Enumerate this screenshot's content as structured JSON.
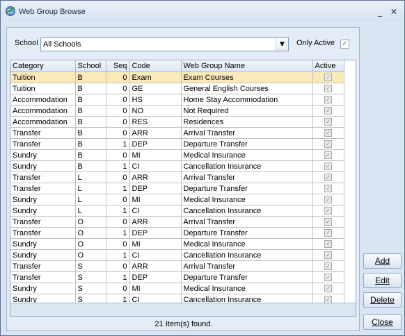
{
  "window": {
    "title": "Web Group Browse",
    "min_icon": "minimize-icon",
    "close_icon": "close-icon",
    "min_glyph": "_",
    "close_glyph": "✕"
  },
  "filter": {
    "school_label": "School",
    "school_value": "All Schools",
    "only_active_label": "Only Active",
    "only_active_checked": true
  },
  "grid": {
    "columns": [
      "Category",
      "School",
      "Seq",
      "Code",
      "Web Group Name",
      "Active"
    ],
    "rows": [
      {
        "category": "Tuition",
        "school": "B",
        "seq": "0",
        "code": "Exam",
        "name": "Exam Courses",
        "active": true
      },
      {
        "category": "Tuition",
        "school": "B",
        "seq": "0",
        "code": "GE",
        "name": "General English Courses",
        "active": true
      },
      {
        "category": "Accommodation",
        "school": "B",
        "seq": "0",
        "code": "HS",
        "name": "Home Stay Accommodation",
        "active": true
      },
      {
        "category": "Accommodation",
        "school": "B",
        "seq": "0",
        "code": "NO",
        "name": "Not Required",
        "active": true
      },
      {
        "category": "Accommodation",
        "school": "B",
        "seq": "0",
        "code": "RES",
        "name": "Residences",
        "active": true
      },
      {
        "category": "Transfer",
        "school": "B",
        "seq": "0",
        "code": "ARR",
        "name": "Arrival Transfer",
        "active": true
      },
      {
        "category": "Transfer",
        "school": "B",
        "seq": "1",
        "code": "DEP",
        "name": "Departure Transfer",
        "active": true
      },
      {
        "category": "Sundry",
        "school": "B",
        "seq": "0",
        "code": "MI",
        "name": "Medical Insurance",
        "active": true
      },
      {
        "category": "Sundry",
        "school": "B",
        "seq": "1",
        "code": "CI",
        "name": "Cancellation Insurance",
        "active": true
      },
      {
        "category": "Transfer",
        "school": "L",
        "seq": "0",
        "code": "ARR",
        "name": "Arrival Transfer",
        "active": true
      },
      {
        "category": "Transfer",
        "school": "L",
        "seq": "1",
        "code": "DEP",
        "name": "Departure Transfer",
        "active": true
      },
      {
        "category": "Sundry",
        "school": "L",
        "seq": "0",
        "code": "MI",
        "name": "Medical Insurance",
        "active": true
      },
      {
        "category": "Sundry",
        "school": "L",
        "seq": "1",
        "code": "CI",
        "name": "Cancellation Insurance",
        "active": true
      },
      {
        "category": "Transfer",
        "school": "O",
        "seq": "0",
        "code": "ARR",
        "name": "Arrival Transfer",
        "active": true
      },
      {
        "category": "Transfer",
        "school": "O",
        "seq": "1",
        "code": "DEP",
        "name": "Departure Transfer",
        "active": true
      },
      {
        "category": "Sundry",
        "school": "O",
        "seq": "0",
        "code": "MI",
        "name": "Medical Insurance",
        "active": true
      },
      {
        "category": "Sundry",
        "school": "O",
        "seq": "1",
        "code": "CI",
        "name": "Cancellation Insurance",
        "active": true
      },
      {
        "category": "Transfer",
        "school": "S",
        "seq": "0",
        "code": "ARR",
        "name": "Arrival Transfer",
        "active": true
      },
      {
        "category": "Transfer",
        "school": "S",
        "seq": "1",
        "code": "DEP",
        "name": "Departure Transfer",
        "active": true
      },
      {
        "category": "Sundry",
        "school": "S",
        "seq": "0",
        "code": "MI",
        "name": "Medical Insurance",
        "active": true
      },
      {
        "category": "Sundry",
        "school": "S",
        "seq": "1",
        "code": "CI",
        "name": "Cancellation Insurance",
        "active": true
      }
    ],
    "selected_row": 0
  },
  "status": {
    "text": "21 Item(s) found."
  },
  "buttons": {
    "add": "Add",
    "edit": "Edit",
    "delete": "Delete",
    "close": "Close"
  },
  "colors": {
    "selected_row": "#fbeab9",
    "window_bg": "#d9e5f3",
    "check_mark": "#2e8b2e"
  }
}
